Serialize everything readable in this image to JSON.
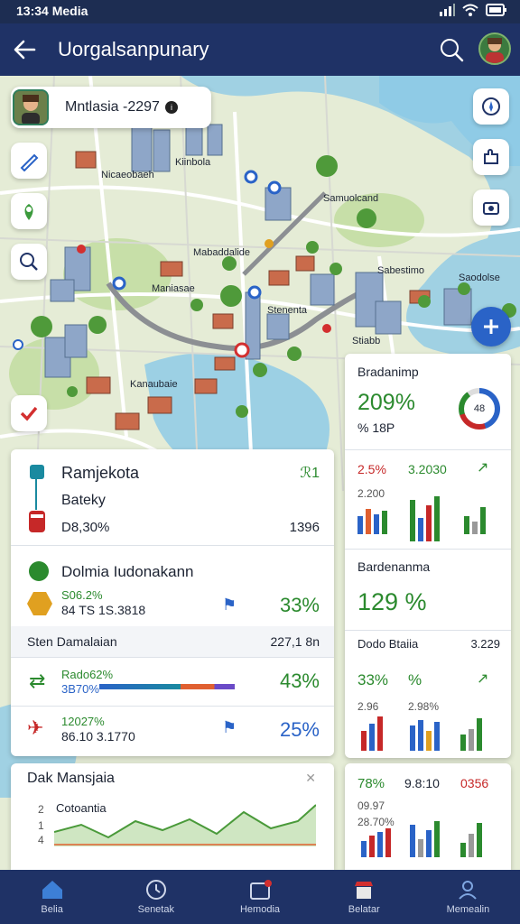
{
  "status": {
    "time": "13:34 Media"
  },
  "appbar": {
    "title": "Uorgalsanpunary"
  },
  "location": {
    "label": "Mntlasia -2297"
  },
  "map_labels": [
    {
      "text": "Nicaeobaeh"
    },
    {
      "text": "Kiinbola"
    },
    {
      "text": "Samuolcand"
    },
    {
      "text": "Mabaddalide"
    },
    {
      "text": "Sabestimo"
    },
    {
      "text": "Saodolse"
    },
    {
      "text": "Maniasae"
    },
    {
      "text": "Stenenta"
    },
    {
      "text": "Stiabb"
    },
    {
      "text": "Kanaubaie"
    }
  ],
  "card_a": {
    "title": "Ramjekota",
    "badge": "ℛ1",
    "sub": "Bateky",
    "meta": "D8,30%",
    "value": "1396"
  },
  "card_b": {
    "title": "Dolmia Iudonakann",
    "line1": "S06.2%",
    "line2": "84 TS  1S.3818",
    "pct": "33%"
  },
  "card_b2": {
    "label": "Sten Damalaian",
    "value": "227,1 8n"
  },
  "card_c": {
    "line1": "Rado62%",
    "line2": "3B70%",
    "pct": "43%"
  },
  "card_d": {
    "line1": "12027%",
    "line2": "86.10  3.1770",
    "pct": "25%"
  },
  "chart_card": {
    "title": "Dak Mansjaia",
    "legend": "Cotoantia",
    "ticks": [
      "2",
      "1",
      "4"
    ]
  },
  "side1": {
    "title": "Bradanimp",
    "pct": "209%",
    "sub": "% 18P",
    "donut": "48"
  },
  "side2": {
    "a": "2.5%",
    "b": "3.2030",
    "c": "2.200"
  },
  "side3": {
    "title": "Bardenanma",
    "pct": "129 %"
  },
  "side4": {
    "title": "Dodo Btaiia",
    "value": "3.229",
    "a": "33%",
    "b": "%"
  },
  "side4b": {
    "a": "2.96",
    "b": "2.98%"
  },
  "side5": {
    "a": "78%",
    "b": "9.8:10",
    "c": "0356",
    "d": "09.97",
    "e": "28.70%"
  },
  "nav": [
    {
      "label": "Belia"
    },
    {
      "label": "Senetak"
    },
    {
      "label": "Hemodia"
    },
    {
      "label": "Belatar"
    },
    {
      "label": "Memealin"
    }
  ]
}
